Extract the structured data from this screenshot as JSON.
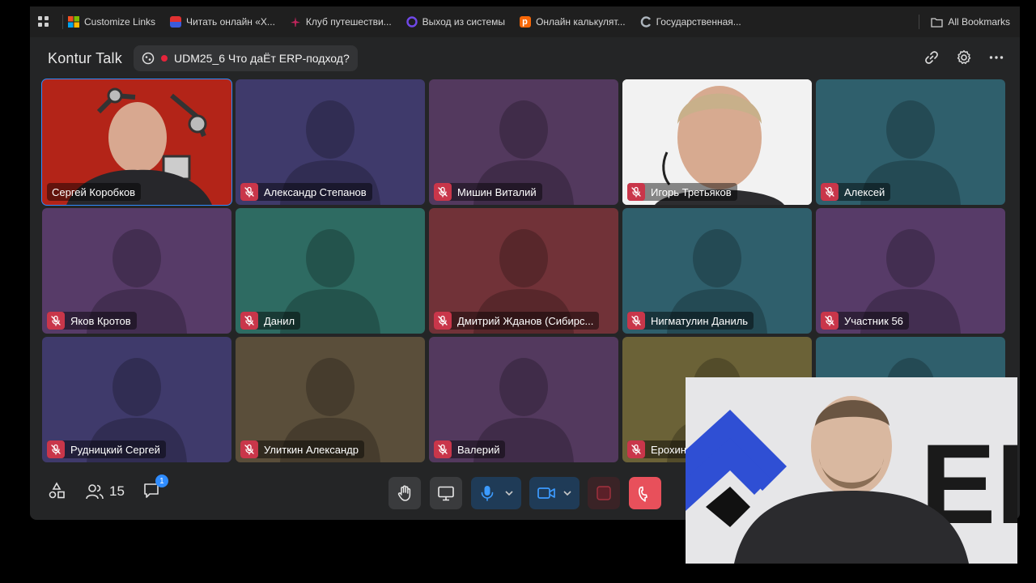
{
  "bookmarks": {
    "items": [
      {
        "label": "Customize Links",
        "color": "#f25022"
      },
      {
        "label": "Читать онлайн «Х...",
        "color": "#3b5bdb"
      },
      {
        "label": "Клуб путешестви...",
        "color": "#c2255c"
      },
      {
        "label": "Выход из системы",
        "color": "#5f3dc4"
      },
      {
        "label": "Онлайн калькулят...",
        "color": "#f76707"
      },
      {
        "label": "Государственная...",
        "color": "#868e96"
      }
    ],
    "all_label": "All Bookmarks"
  },
  "app": {
    "logo": "Kontur Talk",
    "meeting_title": "UDM25_6 Что даЁт ERP-подход?"
  },
  "participants": [
    {
      "name": "Сергей Коробков",
      "muted": false,
      "active": true,
      "video": true,
      "bg": "#b32418"
    },
    {
      "name": "Александр Степанов",
      "muted": true,
      "bg": "#3f3a6b"
    },
    {
      "name": "Мишин Виталий",
      "muted": true,
      "bg": "#53395e"
    },
    {
      "name": "Игорь Третьяков",
      "muted": true,
      "video": true,
      "bg": "#f2f2f2"
    },
    {
      "name": "Алексей",
      "muted": true,
      "bg": "#2f5f6c"
    },
    {
      "name": "Яков Кротов",
      "muted": true,
      "bg": "#573b68"
    },
    {
      "name": "Данил",
      "muted": true,
      "bg": "#2e6b62"
    },
    {
      "name": "Дмитрий Жданов (Сибирс...",
      "muted": true,
      "bg": "#713238"
    },
    {
      "name": "Нигматулин Даниль",
      "muted": true,
      "bg": "#2f5f6c"
    },
    {
      "name": "Участник 56",
      "muted": true,
      "bg": "#573b68"
    },
    {
      "name": "Рудницкий Сергей",
      "muted": true,
      "bg": "#3f3a6b"
    },
    {
      "name": "Улиткин Александр",
      "muted": true,
      "bg": "#5a4e3a"
    },
    {
      "name": "Валерий",
      "muted": true,
      "bg": "#53395e"
    },
    {
      "name": "Ерохин",
      "muted": true,
      "bg": "#6b6237"
    },
    {
      "name": "",
      "muted": true,
      "bg": "#2f5f6c"
    }
  ],
  "toolbar": {
    "participants_count": "15",
    "chat_badge": "1"
  },
  "pip": {
    "logo_text": "ERP"
  }
}
